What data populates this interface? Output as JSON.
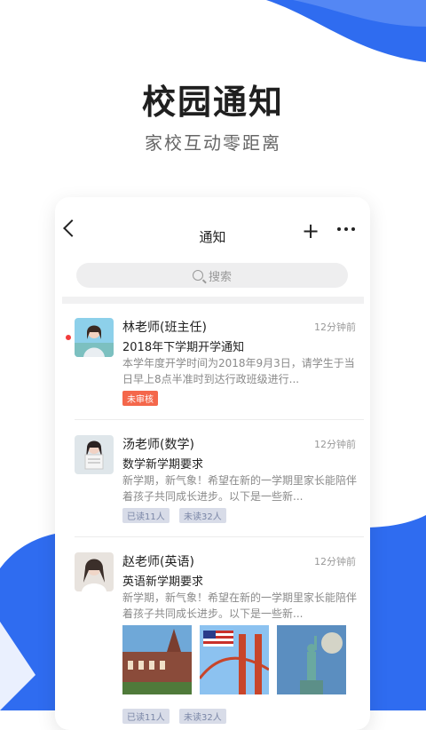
{
  "hero": {
    "title": "校园通知",
    "subtitle": "家校互动零距离"
  },
  "nav": {
    "title": "通知",
    "back_icon": "chevron-left-icon",
    "add_icon": "plus-icon",
    "more_icon": "more-dots-icon"
  },
  "search": {
    "placeholder": "搜索"
  },
  "notices": [
    {
      "sender": "林老师(班主任)",
      "time": "12分钟前",
      "subject": "2018年下学期开学通知",
      "excerpt": "本学年度开学时间为2018年9月3日，请学生于当日早上8点半准时到达行政班级进行...",
      "unread": true,
      "tags": [
        "未审核"
      ]
    },
    {
      "sender": "汤老师(数学)",
      "time": "12分钟前",
      "subject": "数学新学期要求",
      "excerpt": "新学期，新气象！希望在新的一学期里家长能陪伴着孩子共同成长进步。以下是一些新...",
      "unread": false,
      "tags": [
        "已读11人",
        "未读32人"
      ]
    },
    {
      "sender": "赵老师(英语)",
      "time": "12分钟前",
      "subject": "英语新学期要求",
      "excerpt": "新学期，新气象！希望在新的一学期里家长能陪伴着孩子共同成长进步。以下是一些新...",
      "unread": false,
      "tags": [
        "已读11人",
        "未读32人"
      ]
    }
  ],
  "colors": {
    "accent_blue": "#2f6cf0",
    "tag_red": "#f4674b",
    "tag_gray_bg": "#d8dce8",
    "unread_dot": "#f23c3c"
  }
}
